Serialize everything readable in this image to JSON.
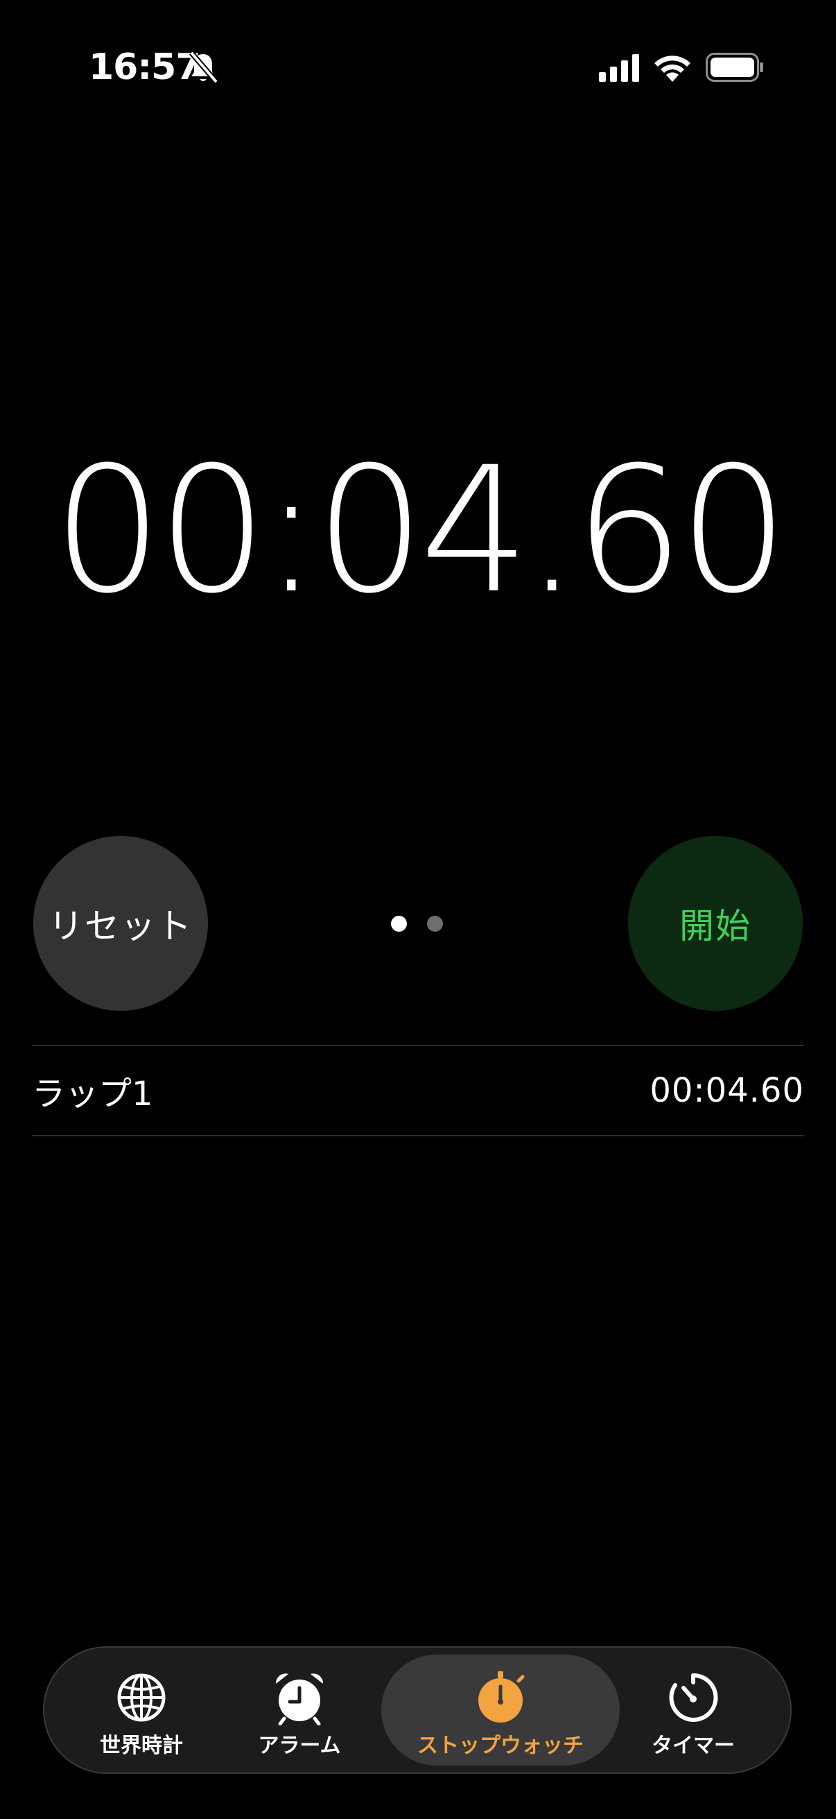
{
  "status_bar": {
    "time": "16:57"
  },
  "stopwatch": {
    "display": "00:04.60",
    "reset_label": "リセット",
    "start_label": "開始",
    "page_count": 2,
    "active_page": 1
  },
  "laps": [
    {
      "label": "ラップ1",
      "time": "00:04.60"
    }
  ],
  "tab_bar": {
    "tabs": [
      {
        "label": "世界時計",
        "icon": "globe-icon",
        "active": false
      },
      {
        "label": "アラーム",
        "icon": "alarm-clock-icon",
        "active": false
      },
      {
        "label": "ストップウォッチ",
        "icon": "stopwatch-icon",
        "active": true
      },
      {
        "label": "タイマー",
        "icon": "timer-icon",
        "active": false
      }
    ]
  },
  "colors": {
    "background": "#000000",
    "reset_button": "#333333",
    "start_button_bg": "#0c2a12",
    "start_button_text": "#3fd25a",
    "active_tab": "#f3a33f"
  }
}
